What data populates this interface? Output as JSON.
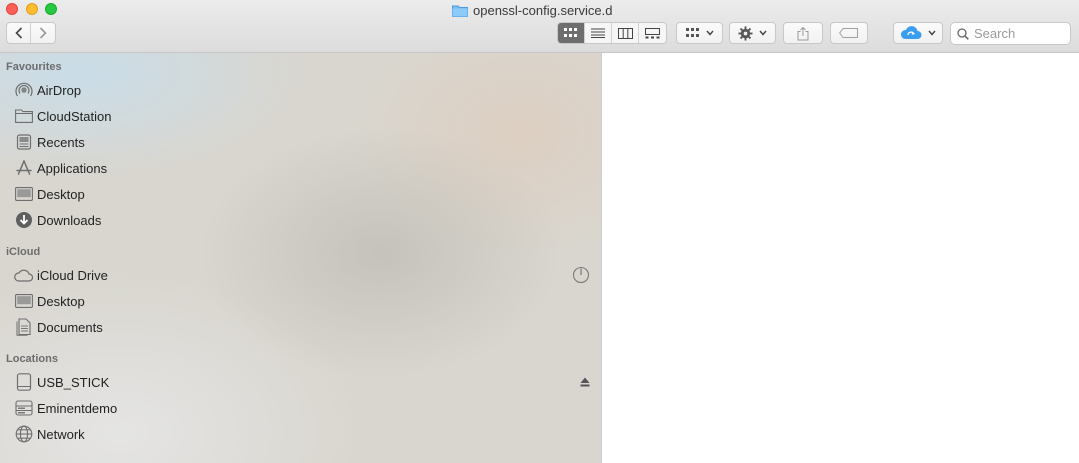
{
  "window": {
    "title": "openssl-config.service.d"
  },
  "toolbar": {
    "back_icon": "chevron-left-icon",
    "forward_icon": "chevron-right-icon",
    "view_modes": [
      "icon-view",
      "list-view",
      "column-view",
      "gallery-view"
    ],
    "active_view": "icon-view",
    "search_placeholder": "Search"
  },
  "sidebar": {
    "sections": [
      {
        "title": "Favourites",
        "items": [
          {
            "label": "AirDrop",
            "icon": "airdrop-icon"
          },
          {
            "label": "CloudStation",
            "icon": "folder-icon"
          },
          {
            "label": "Recents",
            "icon": "recents-icon"
          },
          {
            "label": "Applications",
            "icon": "applications-icon"
          },
          {
            "label": "Desktop",
            "icon": "desktop-icon"
          },
          {
            "label": "Downloads",
            "icon": "downloads-icon"
          }
        ]
      },
      {
        "title": "iCloud",
        "items": [
          {
            "label": "iCloud Drive",
            "icon": "icloud-icon"
          },
          {
            "label": "Desktop",
            "icon": "desktop-icon"
          },
          {
            "label": "Documents",
            "icon": "documents-icon"
          }
        ]
      },
      {
        "title": "Locations",
        "items": [
          {
            "label": "USB_STICK",
            "icon": "drive-icon"
          },
          {
            "label": "Eminentdemo",
            "icon": "server-icon"
          },
          {
            "label": "Network",
            "icon": "network-icon"
          }
        ]
      }
    ]
  },
  "colors": {
    "close": "#fe5f57",
    "minimize": "#febc2e",
    "maximize": "#28c840",
    "folder": "#6cb5f0",
    "icloud": "#3a9ef0"
  }
}
